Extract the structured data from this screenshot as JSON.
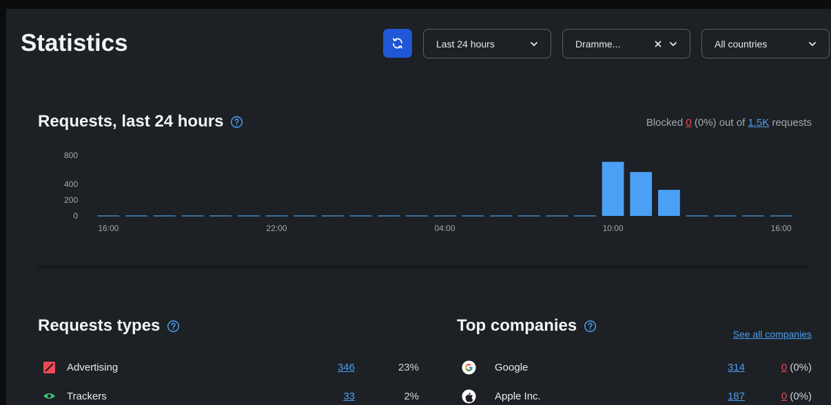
{
  "header": {
    "title": "Statistics",
    "refresh_icon": "refresh-icon",
    "period_select": "Last 24 hours",
    "device_select": "Dramme...",
    "country_select": "All countries"
  },
  "requests_section": {
    "title": "Requests, last 24 hours",
    "summary_prefix": "Blocked",
    "blocked_count": "0",
    "blocked_pct": "(0%) out of",
    "total_requests": "1.5K",
    "summary_suffix": "requests"
  },
  "chart_data": {
    "type": "bar",
    "y_ticks": [
      "800",
      "400",
      "200",
      "0"
    ],
    "ylim": [
      0,
      800
    ],
    "x_tick_labels": [
      "16:00",
      "22:00",
      "04:00",
      "10:00",
      "16:00"
    ],
    "categories": [
      "16:00",
      "17:00",
      "18:00",
      "19:00",
      "20:00",
      "21:00",
      "22:00",
      "23:00",
      "00:00",
      "01:00",
      "02:00",
      "03:00",
      "04:00",
      "05:00",
      "06:00",
      "07:00",
      "08:00",
      "09:00",
      "10:00",
      "11:00",
      "12:00",
      "13:00",
      "14:00",
      "15:00",
      "16:00"
    ],
    "values": [
      0,
      0,
      0,
      0,
      0,
      0,
      0,
      0,
      0,
      0,
      0,
      0,
      0,
      0,
      0,
      0,
      0,
      0,
      715,
      580,
      345,
      0,
      0,
      0,
      0
    ],
    "bar_color": "#4aa0f5"
  },
  "request_types": {
    "title": "Requests types",
    "rows": [
      {
        "icon": "advertising-icon",
        "name": "Advertising",
        "count": "346",
        "pct": "23%"
      },
      {
        "icon": "trackers-eye-icon",
        "name": "Trackers",
        "count": "33",
        "pct": "2%"
      }
    ]
  },
  "top_companies": {
    "title": "Top companies",
    "see_all": "See all companies",
    "rows": [
      {
        "icon": "google-icon",
        "name": "Google",
        "count": "314",
        "blocked": "0",
        "blocked_pct": "(0%)"
      },
      {
        "icon": "apple-icon",
        "name": "Apple Inc.",
        "count": "187",
        "blocked": "0",
        "blocked_pct": "(0%)"
      }
    ]
  },
  "colors": {
    "accent_blue": "#1f57d6",
    "link_blue": "#4c9ef2",
    "danger_red": "#ef4a58",
    "card_bg": "#1d2024"
  }
}
